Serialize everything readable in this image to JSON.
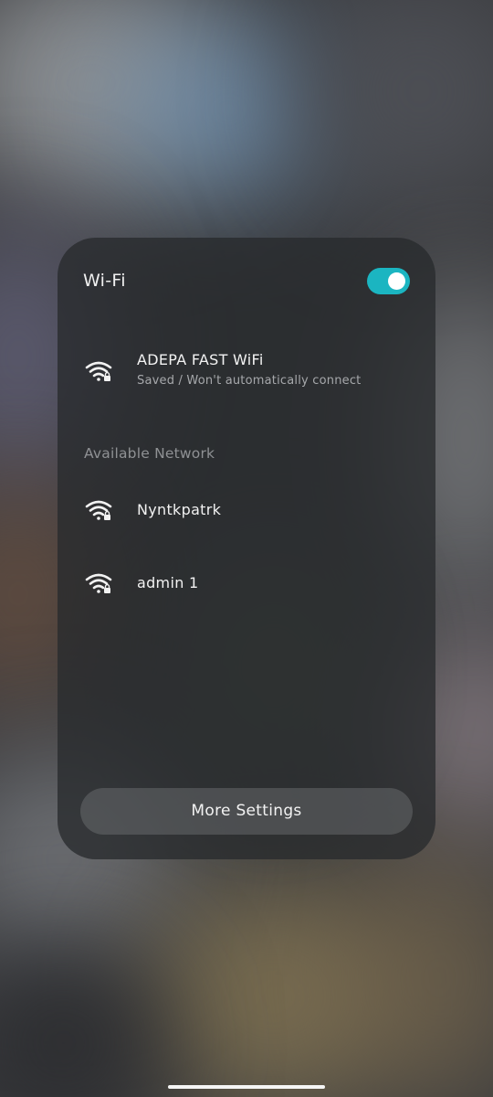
{
  "panel": {
    "title": "Wi-Fi",
    "toggle_on": true,
    "accent_color": "#1bb5c1"
  },
  "saved_network": {
    "name": "ADEPA FAST WiFi",
    "status": "Saved / Won't automatically connect",
    "icon": "wifi-lock-icon"
  },
  "available": {
    "label": "Available Network",
    "networks": [
      {
        "name": "Nyntkpatrk",
        "icon": "wifi-lock-icon"
      },
      {
        "name": "admin 1",
        "icon": "wifi-lock-icon"
      }
    ]
  },
  "more_settings": {
    "label": "More Settings"
  }
}
